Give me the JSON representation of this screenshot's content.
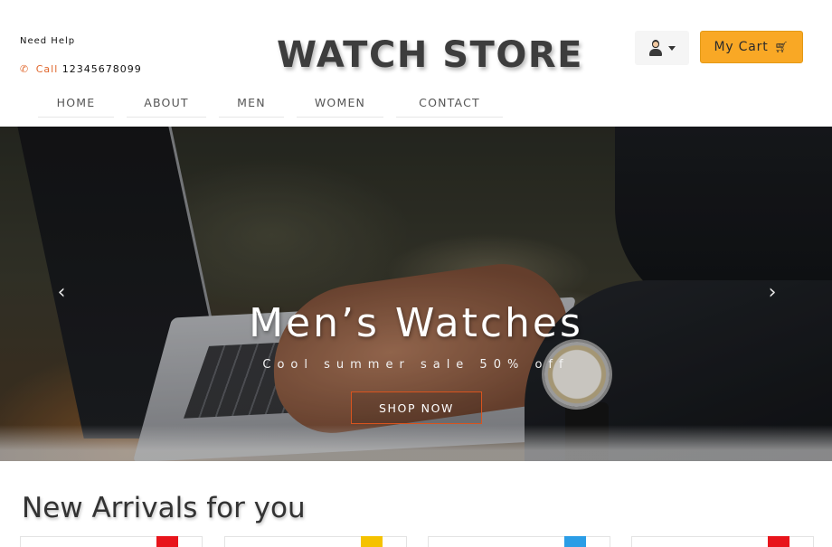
{
  "header": {
    "need_help": "Need Help",
    "call_label": "Call",
    "phone": "12345678099",
    "brand": "WATCH STORE",
    "cart_label": "My Cart"
  },
  "icons": {
    "phone": "phone-icon",
    "user": "user-icon",
    "caret": "caret-down-icon",
    "cart": "cart-icon",
    "prev": "chevron-left-icon",
    "next": "chevron-right-icon"
  },
  "nav": {
    "home": "HOME",
    "about": "ABOUT",
    "men": "MEN",
    "women": "WOMEN",
    "contact": "CONTACT"
  },
  "hero": {
    "title": "Men’s Watches",
    "subtitle": "Cool summer sale 50% off",
    "cta": "SHOP NOW",
    "prev_glyph": "‹",
    "next_glyph": "›"
  },
  "arrivals": {
    "title": "New Arrivals for you",
    "card_badges": [
      "#e8141b",
      "#f5c200",
      "#2b9de6",
      "#e8141b"
    ]
  },
  "colors": {
    "accent_orange": "#e0662b",
    "cart_yellow": "#f9a825",
    "cta_border": "#d9541e"
  }
}
